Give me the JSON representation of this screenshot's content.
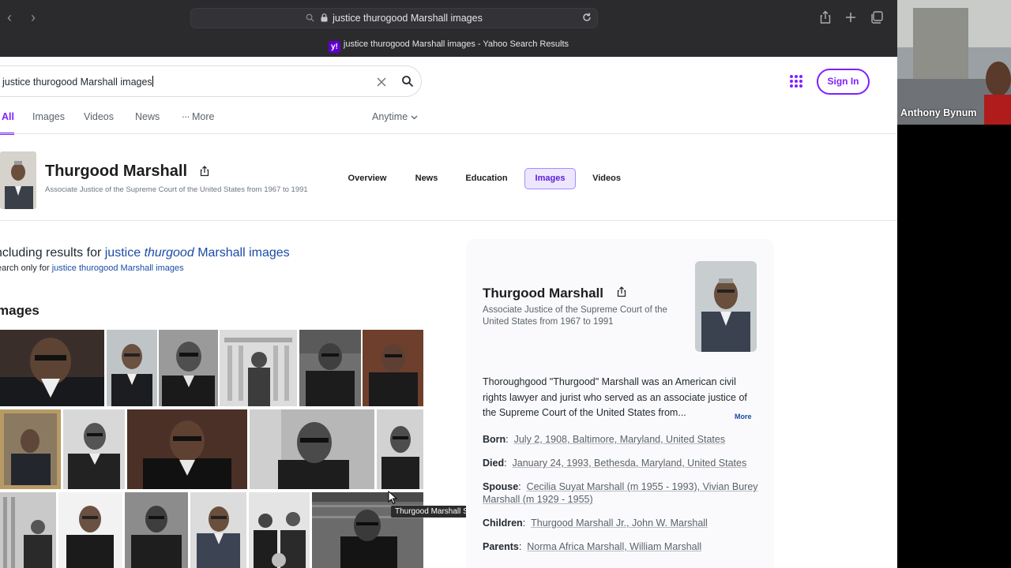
{
  "browser": {
    "address": "justice thurogood Marshall images",
    "tab_title": "justice thurogood Marshall images - Yahoo Search Results",
    "tab_favicon": "y!"
  },
  "search": {
    "query": "justice thurogood Marshall images",
    "sign_in": "Sign In"
  },
  "vertical_tabs": [
    {
      "label": "All",
      "active": true
    },
    {
      "label": "Images"
    },
    {
      "label": "Videos"
    },
    {
      "label": "News"
    },
    {
      "label": "More"
    }
  ],
  "anytime": "Anytime",
  "entity": {
    "name": "Thurgood Marshall",
    "subtitle": "Associate Justice of the Supreme Court of the United States from 1967 to 1991",
    "tabs": [
      "Overview",
      "News",
      "Education",
      "Images",
      "Videos"
    ],
    "active_tab": "Images"
  },
  "correction": {
    "prefix": "ncluding results for",
    "link_a": "justice",
    "link_em": "thurgood",
    "link_b": "Marshall images",
    "only_prefix": "earch only for",
    "only_link": "justice thurogood Marshall images"
  },
  "images_heading": "mages",
  "tooltip": "Thurgood Marshall Supreme Court Justice",
  "panel": {
    "name": "Thurgood Marshall",
    "subtitle": "Associate Justice of the Supreme Court of the United States from 1967 to 1991",
    "description": "Thoroughgood \"Thurgood\" Marshall was an American civil rights lawyer and jurist who served as an associate justice of the Supreme Court of the United States from...",
    "more": "More",
    "facts": [
      {
        "label": "Born",
        "value": "July 2, 1908, Baltimore, Maryland, United States"
      },
      {
        "label": "Died",
        "value": "January 24, 1993, Bethesda, Maryland, United States"
      },
      {
        "label": "Spouse",
        "value": "Cecilia Suyat Marshall (m 1955 - 1993), Vivian Burey Marshall (m 1929 - 1955)"
      },
      {
        "label": "Children",
        "value": "Thurgood Marshall Jr., John W. Marshall"
      },
      {
        "label": "Parents",
        "value": "Norma Africa Marshall, William Marshall"
      }
    ]
  },
  "video": {
    "participant": "Anthony Bynum"
  },
  "colors": {
    "accent": "#7e1fff",
    "link": "#1a4ba6"
  }
}
